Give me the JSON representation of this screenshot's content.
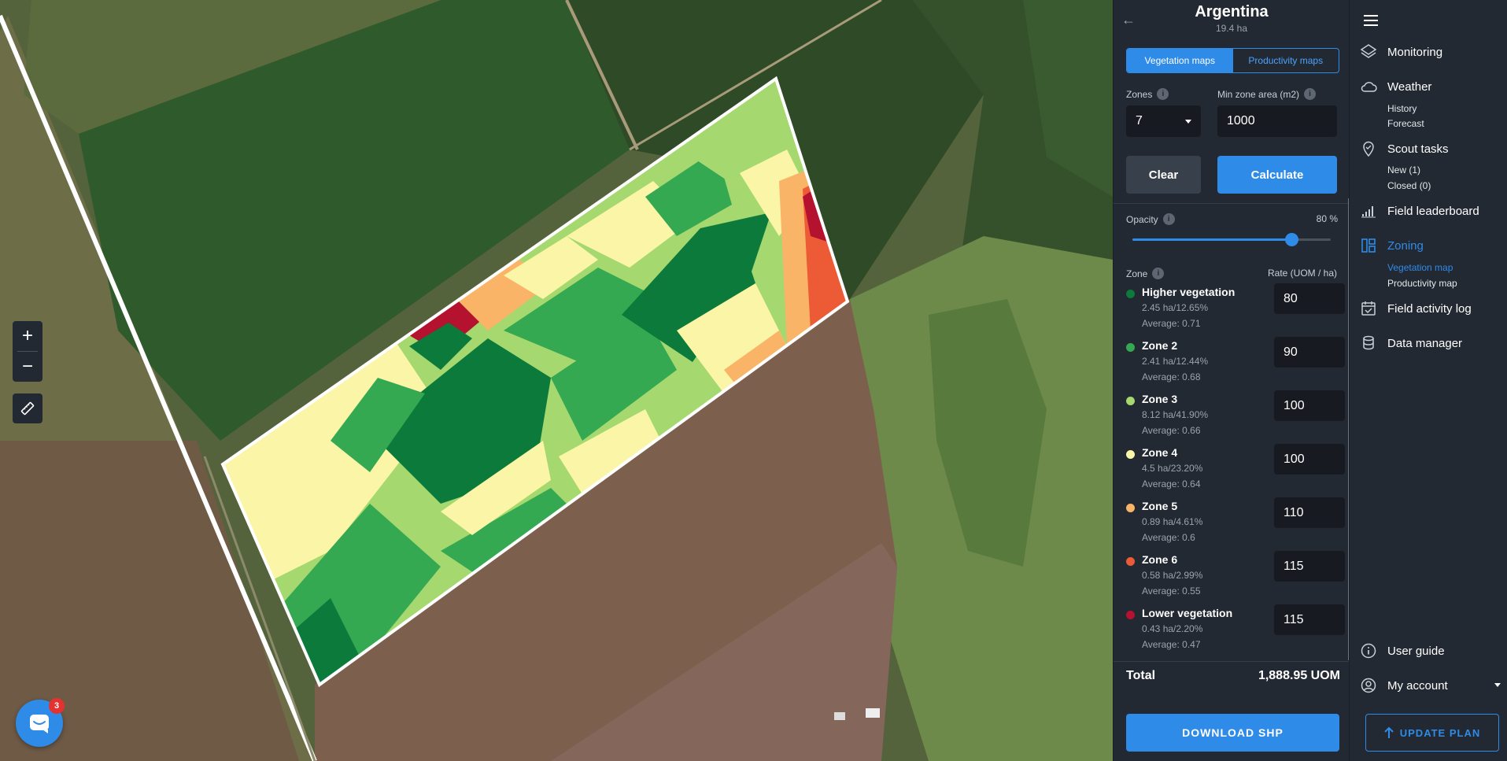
{
  "map": {
    "zoom_in": "+",
    "zoom_out": "−",
    "chat_badge": "3"
  },
  "field": {
    "title": "Argentina",
    "area": "19.4 ha"
  },
  "tabs": [
    {
      "label": "Vegetation maps",
      "active": true
    },
    {
      "label": "Productivity maps",
      "active": false
    }
  ],
  "settings": {
    "zones_label": "Zones",
    "zones_value": "7",
    "min_area_label": "Min zone area (m2)",
    "min_area_value": "1000",
    "clear_label": "Clear",
    "calculate_label": "Calculate",
    "opacity_label": "Opacity",
    "opacity_value": "80 %",
    "opacity_fraction": 0.8
  },
  "zones_header": {
    "zone_label": "Zone",
    "rate_label": "Rate (UOM / ha)"
  },
  "zones": [
    {
      "name": "Higher vegetation",
      "area": "2.45 ha/12.65%",
      "average": "Average: 0.71",
      "rate": "80",
      "color": "#0b7a3b"
    },
    {
      "name": "Zone 2",
      "area": "2.41 ha/12.44%",
      "average": "Average: 0.68",
      "rate": "90",
      "color": "#35a852"
    },
    {
      "name": "Zone 3",
      "area": "8.12 ha/41.90%",
      "average": "Average: 0.66",
      "rate": "100",
      "color": "#a5d86e"
    },
    {
      "name": "Zone 4",
      "area": "4.5 ha/23.20%",
      "average": "Average: 0.64",
      "rate": "100",
      "color": "#fbf5a8"
    },
    {
      "name": "Zone 5",
      "area": "0.89 ha/4.61%",
      "average": "Average: 0.6",
      "rate": "110",
      "color": "#f9b467"
    },
    {
      "name": "Zone 6",
      "area": "0.58 ha/2.99%",
      "average": "Average: 0.55",
      "rate": "115",
      "color": "#ec5a36"
    },
    {
      "name": "Lower vegetation",
      "area": "0.43 ha/2.20%",
      "average": "Average: 0.47",
      "rate": "115",
      "color": "#b4122e"
    }
  ],
  "total": {
    "label": "Total",
    "value": "1,888.95 UOM"
  },
  "download_label": "DOWNLOAD SHP",
  "nav": {
    "items": [
      {
        "label": "Monitoring",
        "icon": "layers-icon"
      },
      {
        "label": "Weather",
        "icon": "cloud-icon"
      },
      {
        "label": "Scout tasks",
        "icon": "map-pin-icon"
      },
      {
        "label": "Field leaderboard",
        "icon": "signal-bars-icon"
      },
      {
        "label": "Zoning",
        "icon": "zoning-icon"
      },
      {
        "label": "Field activity log",
        "icon": "calendar-check-icon"
      },
      {
        "label": "Data manager",
        "icon": "database-icon"
      }
    ],
    "weather_sub": [
      "History",
      "Forecast"
    ],
    "scout_sub": [
      "New (1)",
      "Closed (0)"
    ],
    "zoning_sub": [
      "Vegetation map",
      "Productivity map"
    ],
    "user_guide": "User guide",
    "my_account": "My account",
    "update_plan": "UPDATE PLAN"
  }
}
